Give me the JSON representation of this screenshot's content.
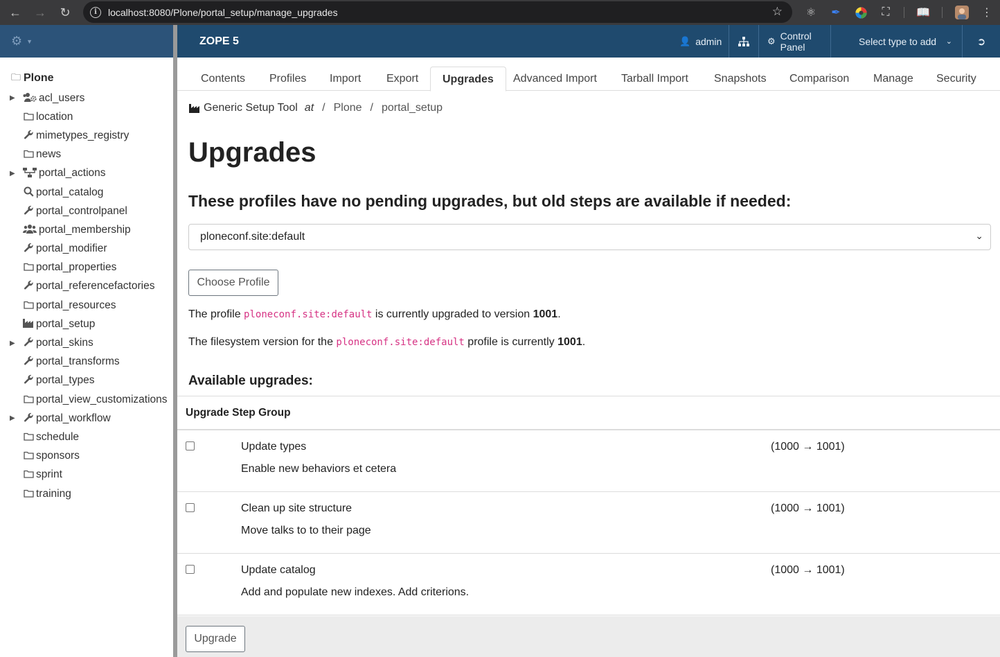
{
  "browser": {
    "url": "localhost:8080/Plone/portal_setup/manage_upgrades"
  },
  "topbar": {
    "brand": "ZOPE 5",
    "user": "admin",
    "control_panel": "Control Panel",
    "add_select": "Select type to add"
  },
  "tree": {
    "root": "Plone",
    "items": [
      {
        "label": "acl_users",
        "icon": "users-cog-icon",
        "expandable": true
      },
      {
        "label": "location",
        "icon": "folder-icon",
        "expandable": false
      },
      {
        "label": "mimetypes_registry",
        "icon": "wrench-icon",
        "expandable": false
      },
      {
        "label": "news",
        "icon": "folder-icon",
        "expandable": false
      },
      {
        "label": "portal_actions",
        "icon": "sitemap-icon",
        "expandable": true
      },
      {
        "label": "portal_catalog",
        "icon": "search-icon",
        "expandable": false
      },
      {
        "label": "portal_controlpanel",
        "icon": "wrench-icon",
        "expandable": false
      },
      {
        "label": "portal_membership",
        "icon": "users-icon",
        "expandable": false
      },
      {
        "label": "portal_modifier",
        "icon": "wrench-icon",
        "expandable": false
      },
      {
        "label": "portal_properties",
        "icon": "folder-icon",
        "expandable": false
      },
      {
        "label": "portal_referencefactories",
        "icon": "wrench-icon",
        "expandable": false
      },
      {
        "label": "portal_resources",
        "icon": "folder-icon",
        "expandable": false
      },
      {
        "label": "portal_setup",
        "icon": "industry-icon",
        "expandable": false
      },
      {
        "label": "portal_skins",
        "icon": "wrench-icon",
        "expandable": true
      },
      {
        "label": "portal_transforms",
        "icon": "wrench-icon",
        "expandable": false
      },
      {
        "label": "portal_types",
        "icon": "wrench-icon",
        "expandable": false
      },
      {
        "label": "portal_view_customizations",
        "icon": "folder-icon",
        "expandable": false
      },
      {
        "label": "portal_workflow",
        "icon": "wrench-icon",
        "expandable": true
      },
      {
        "label": "schedule",
        "icon": "folder-icon",
        "expandable": false
      },
      {
        "label": "sponsors",
        "icon": "folder-icon",
        "expandable": false
      },
      {
        "label": "sprint",
        "icon": "folder-icon",
        "expandable": false
      },
      {
        "label": "training",
        "icon": "folder-icon",
        "expandable": false
      }
    ]
  },
  "tabs": [
    {
      "label": "Contents",
      "active": false
    },
    {
      "label": "Profiles",
      "active": false
    },
    {
      "label": "Import",
      "active": false
    },
    {
      "label": "Export",
      "active": false
    },
    {
      "label": "Upgrades",
      "active": true
    },
    {
      "label": "Advanced Import",
      "active": false
    },
    {
      "label": "Tarball Import",
      "active": false
    },
    {
      "label": "Snapshots",
      "active": false
    },
    {
      "label": "Comparison",
      "active": false
    },
    {
      "label": "Manage",
      "active": false
    },
    {
      "label": "Security",
      "active": false
    }
  ],
  "breadcrumb": {
    "tool": "Generic Setup Tool",
    "at": "at",
    "parts": [
      "Plone",
      "portal_setup"
    ]
  },
  "page": {
    "title": "Upgrades",
    "subtitle": "These profiles have no pending upgrades, but old steps are available if needed:",
    "profile_selected": "ploneconf.site:default",
    "choose_button": "Choose Profile",
    "line1_pre": "The profile ",
    "line1_code": "ploneconf.site:default",
    "line1_mid": " is currently upgraded to version ",
    "line1_ver": "1001",
    "line1_end": ".",
    "line2_pre": "The filesystem version for the ",
    "line2_code": "ploneconf.site:default",
    "line2_mid": " profile is currently ",
    "line2_ver": "1001",
    "line2_end": ".",
    "available_heading": "Available upgrades:",
    "table_header": "Upgrade Step Group",
    "upgrade_button": "Upgrade"
  },
  "upgrades": [
    {
      "name": "Update types",
      "desc": "Enable new behaviors et cetera",
      "version": "(1000 → 1001)",
      "checked": false
    },
    {
      "name": "Clean up site structure",
      "desc": "Move talks to to their page",
      "version": "(1000 → 1001)",
      "checked": false
    },
    {
      "name": "Update catalog",
      "desc": "Add and populate new indexes. Add criterions.",
      "version": "(1000 → 1001)",
      "checked": false
    }
  ]
}
